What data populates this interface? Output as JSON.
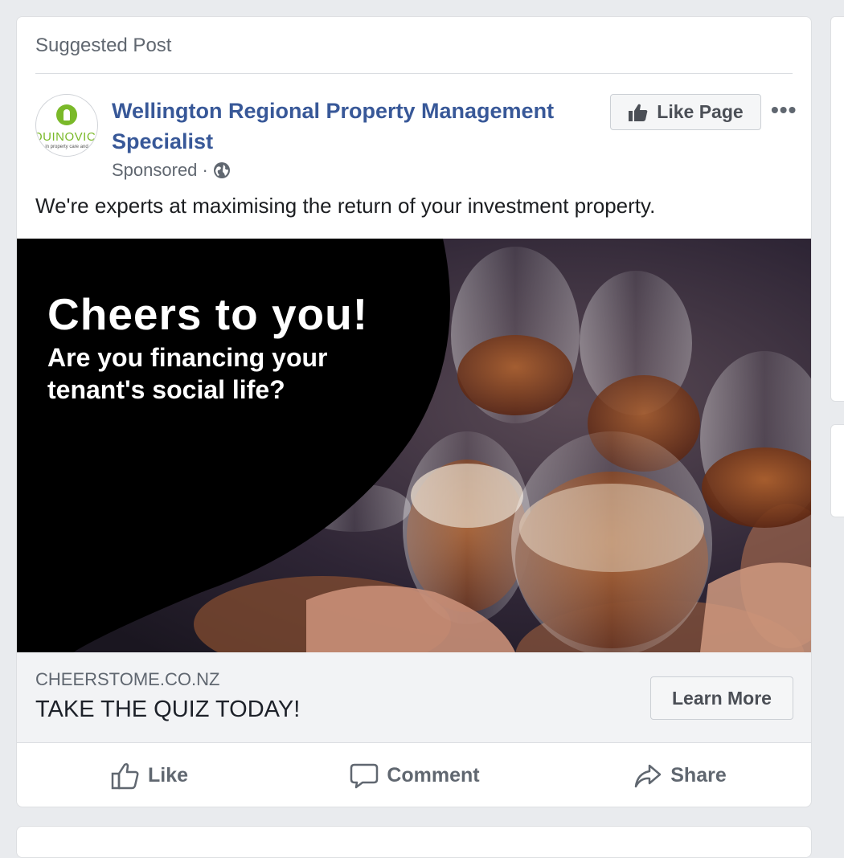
{
  "post": {
    "suggested_label": "Suggested Post",
    "page_name": "Wellington Regional Property Management Specialist",
    "sponsored_label": "Sponsored ·",
    "text": "We're experts at maximising the return of your investment property.",
    "like_page_label": "Like Page",
    "more_label": "•••"
  },
  "avatar": {
    "brand": "QUINOVIC",
    "tagline": "..in property care and..."
  },
  "ad_image": {
    "headline": "Cheers to you!",
    "subline": "Are you financing your tenant's social life?"
  },
  "link": {
    "domain": "CHEERSTOME.CO.NZ",
    "title": "TAKE THE QUIZ TODAY!",
    "cta_label": "Learn More"
  },
  "actions": {
    "like": "Like",
    "comment": "Comment",
    "share": "Share"
  },
  "colors": {
    "page_name": "#385898",
    "brand_green": "#7ab929",
    "background": "#e9ebee"
  },
  "icons": [
    "thumbs-up-icon",
    "globe-icon",
    "speech-bubble-icon",
    "share-arrow-icon",
    "key-icon"
  ]
}
